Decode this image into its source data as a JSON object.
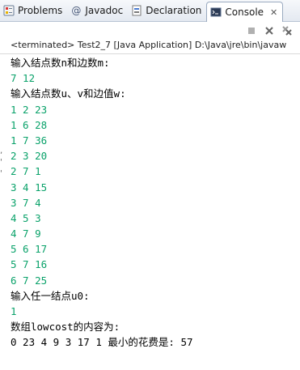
{
  "tabs": [
    {
      "label": "Problems",
      "icon": "problems-icon",
      "active": false
    },
    {
      "label": "Javadoc",
      "icon": "at-icon",
      "active": false
    },
    {
      "label": "Declaration",
      "icon": "declaration-icon",
      "active": false
    },
    {
      "label": "Console",
      "icon": "console-icon",
      "active": true
    }
  ],
  "tab_close": "✕",
  "at_glyph": "@",
  "status": "<terminated> Test2_7 [Java Application] D:\\Java\\jre\\bin\\javaw",
  "console": [
    {
      "text": "输入结点数n和边数m:",
      "kind": "out"
    },
    {
      "text": "7 12",
      "kind": "in"
    },
    {
      "text": "输入结点数u、v和边值w:",
      "kind": "out"
    },
    {
      "text": "1 2 23",
      "kind": "in"
    },
    {
      "text": "1 6 28",
      "kind": "in"
    },
    {
      "text": "1 7 36",
      "kind": "in"
    },
    {
      "text": "2 3 20",
      "kind": "in"
    },
    {
      "text": "2 7 1",
      "kind": "in"
    },
    {
      "text": "3 4 15",
      "kind": "in"
    },
    {
      "text": "3 7 4",
      "kind": "in"
    },
    {
      "text": "4 5 3",
      "kind": "in"
    },
    {
      "text": "4 7 9",
      "kind": "in"
    },
    {
      "text": "5 6 17",
      "kind": "in"
    },
    {
      "text": "5 7 16",
      "kind": "in"
    },
    {
      "text": "6 7 25",
      "kind": "in"
    },
    {
      "text": "输入任一结点u0:",
      "kind": "out"
    },
    {
      "text": "1",
      "kind": "in"
    },
    {
      "text": "数组lowcost的内容为:",
      "kind": "out"
    },
    {
      "text": "0 23 4 9 3 17 1 最小的花费是: 57",
      "kind": "out"
    }
  ],
  "colors": {
    "output": "#000000",
    "input": "#0aa26a"
  }
}
